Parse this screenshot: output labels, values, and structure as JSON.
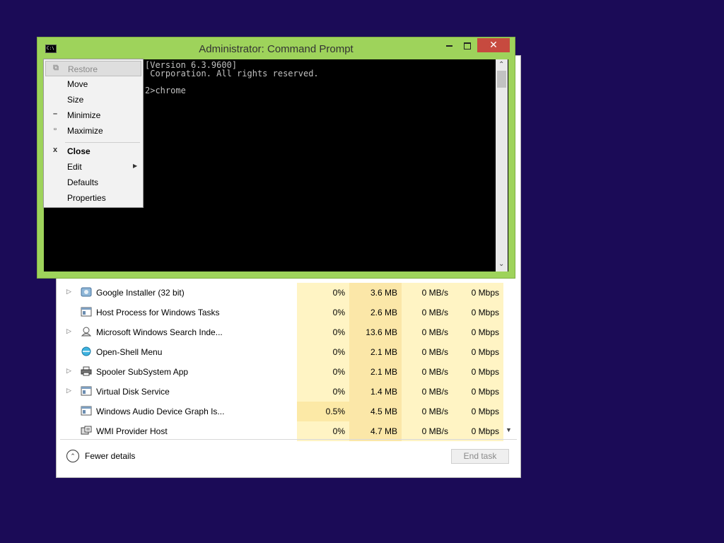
{
  "cmd_window": {
    "title": "Administrator:  Command Prompt",
    "icon": "cmd-icon",
    "console_lines": [
      "[Version 6.3.9600]",
      " Corporation. All rights reserved.",
      "",
      "2>chrome"
    ]
  },
  "system_menu": {
    "items": [
      {
        "label": "Restore",
        "icon": "restore-icon",
        "disabled": true
      },
      {
        "label": "Move"
      },
      {
        "label": "Size"
      },
      {
        "label": "Minimize",
        "icon": "minimize-icon"
      },
      {
        "label": "Maximize",
        "icon": "maximize-icon"
      },
      {
        "label": "Close",
        "icon": "close-icon"
      },
      {
        "label": "Edit",
        "has_submenu": true
      },
      {
        "label": "Defaults"
      },
      {
        "label": "Properties"
      }
    ]
  },
  "task_manager": {
    "rows": [
      {
        "name": "Google Installer (32 bit)",
        "cpu": "0%",
        "memory": "3.6 MB",
        "disk": "0 MB/s",
        "network": "0 Mbps",
        "expandable": true
      },
      {
        "name": "Host Process for Windows Tasks",
        "cpu": "0%",
        "memory": "2.6 MB",
        "disk": "0 MB/s",
        "network": "0 Mbps",
        "expandable": false
      },
      {
        "name": "Microsoft Windows Search Inde...",
        "cpu": "0%",
        "memory": "13.6 MB",
        "disk": "0 MB/s",
        "network": "0 Mbps",
        "expandable": true
      },
      {
        "name": "Open-Shell Menu",
        "cpu": "0%",
        "memory": "2.1 MB",
        "disk": "0 MB/s",
        "network": "0 Mbps",
        "expandable": false
      },
      {
        "name": "Spooler SubSystem App",
        "cpu": "0%",
        "memory": "2.1 MB",
        "disk": "0 MB/s",
        "network": "0 Mbps",
        "expandable": true
      },
      {
        "name": "Virtual Disk Service",
        "cpu": "0%",
        "memory": "1.4 MB",
        "disk": "0 MB/s",
        "network": "0 Mbps",
        "expandable": true
      },
      {
        "name": "Windows Audio Device Graph Is...",
        "cpu": "0.5%",
        "memory": "4.5 MB",
        "disk": "0 MB/s",
        "network": "0 Mbps",
        "expandable": false
      },
      {
        "name": "WMI Provider Host",
        "cpu": "0%",
        "memory": "4.7 MB",
        "disk": "0 MB/s",
        "network": "0 Mbps",
        "expandable": false
      }
    ],
    "fewer_details_label": "Fewer details",
    "end_task_label": "End task"
  }
}
